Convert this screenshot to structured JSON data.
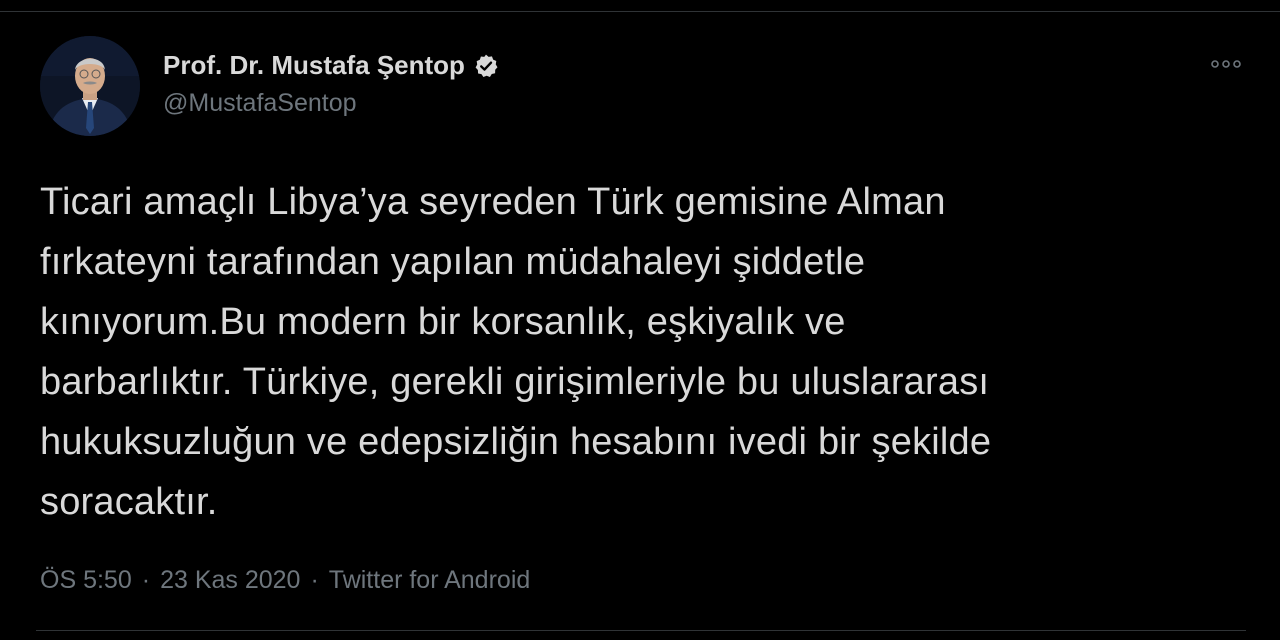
{
  "tweet": {
    "author": {
      "display_name": "Prof. Dr. Mustafa Şentop",
      "handle": "@MustafaSentop",
      "verified": true,
      "avatar_icon": "profile-photo",
      "verified_icon": "verified-badge-icon"
    },
    "more_icon": "more-options-icon",
    "text_lines": [
      "Ticari amaçlı Libya’ya seyreden Türk gemisine Alman",
      "fırkateyni tarafından yapılan müdahaleyi şiddetle",
      "kınıyorum.Bu modern bir korsanlık, eşkiyalık ve",
      "barbarlıktır. Türkiye, gerekli girişimleriyle bu uluslararası",
      "hukuksuzluğun ve edepsizliğin hesabını ivedi bir şekilde",
      "soracaktır."
    ],
    "meta": {
      "time": "ÖS 5:50",
      "separator": "·",
      "date": "23 Kas 2020",
      "source": "Twitter for Android"
    }
  },
  "colors": {
    "background": "#000000",
    "text_primary": "#d9d9d9",
    "text_secondary": "#6e767d",
    "border": "#2f3336",
    "verified_badge": "#d9d9d9"
  }
}
